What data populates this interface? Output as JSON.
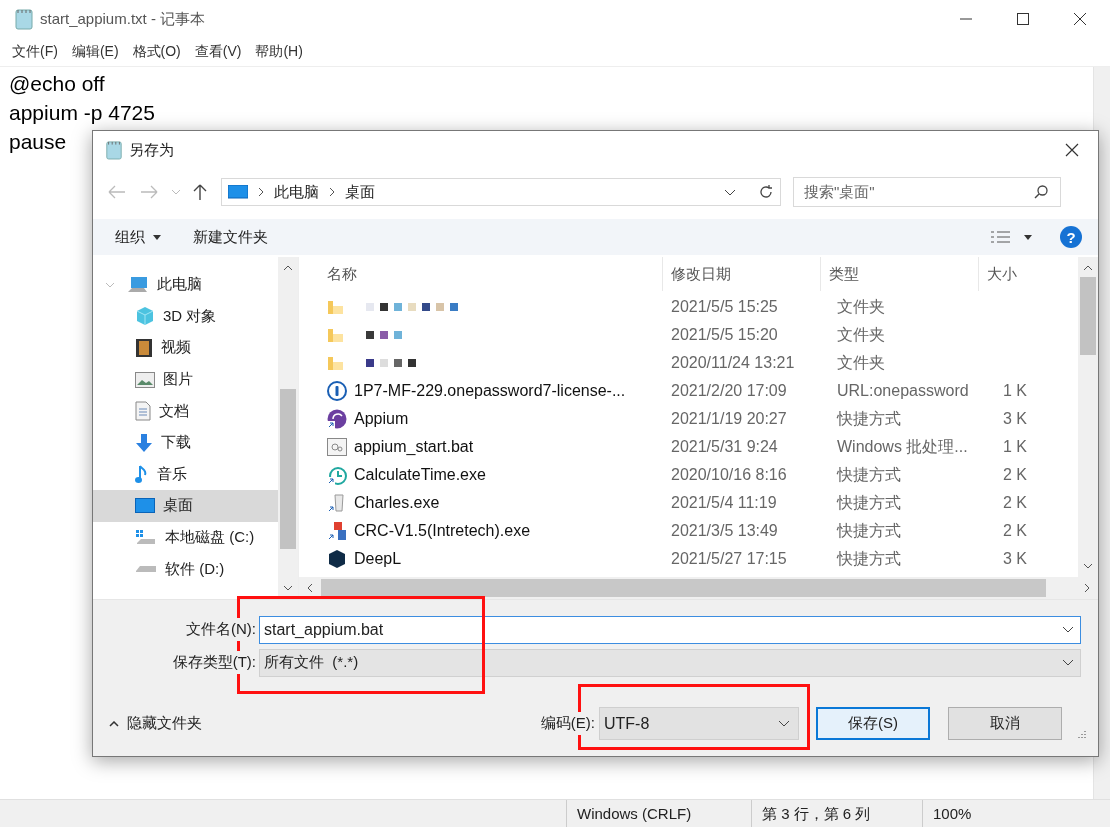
{
  "notepad": {
    "title": "start_appium.txt - 记事本",
    "menu": [
      "文件(F)",
      "编辑(E)",
      "格式(O)",
      "查看(V)",
      "帮助(H)"
    ],
    "lines": [
      "@echo off",
      "appium -p 4725",
      "pause"
    ],
    "status_bar": [
      "Windows (CRLF)",
      "第 3 行，第 6 列",
      "100%"
    ]
  },
  "dialog": {
    "title": "另存为",
    "breadcrumb": [
      "此电脑",
      "桌面"
    ],
    "search": {
      "placeholder": "搜索\"桌面\""
    },
    "organize": "组织",
    "new_folder": "新建文件夹",
    "help": "?",
    "sidebar": {
      "items": [
        {
          "label": "此电脑",
          "kind": "pc",
          "expanded": true,
          "selected": false,
          "children": [
            {
              "label": "3D 对象",
              "kind": "cube",
              "selected": false
            },
            {
              "label": "视频",
              "kind": "video",
              "selected": false
            },
            {
              "label": "图片",
              "kind": "image",
              "selected": false
            },
            {
              "label": "文档",
              "kind": "doc",
              "selected": false
            },
            {
              "label": "下载",
              "kind": "download",
              "selected": false
            },
            {
              "label": "音乐",
              "kind": "music",
              "selected": false
            },
            {
              "label": "桌面",
              "kind": "desktop",
              "selected": true
            },
            {
              "label": "本地磁盘 (C:)",
              "kind": "disk",
              "selected": false
            },
            {
              "label": "软件 (D:)",
              "kind": "drive",
              "selected": false
            }
          ]
        }
      ]
    },
    "columns": [
      "名称",
      "修改日期",
      "类型",
      "大小"
    ],
    "rows": [
      {
        "kind": "folder",
        "blurred": true,
        "date": "2021/5/5 15:25",
        "type": "文件夹"
      },
      {
        "kind": "folder",
        "blurred": true,
        "date": "2021/5/5 15:20",
        "type": "文件夹"
      },
      {
        "kind": "folder",
        "blurred": true,
        "date": "2020/11/24 13:21",
        "type": "文件夹"
      },
      {
        "kind": "url",
        "name": "1P7-MF-229.onepassword7-license-...",
        "date": "2021/2/20 17:09",
        "type": "URL:onepassword",
        "size": "1 K"
      },
      {
        "kind": "appium",
        "name": "Appium",
        "date": "2021/1/19 20:27",
        "type": "快捷方式",
        "size": "3 K"
      },
      {
        "kind": "bat",
        "name": "appium_start.bat",
        "date": "2021/5/31 9:24",
        "type": "Windows 批处理...",
        "size": "1 K"
      },
      {
        "kind": "clock",
        "name": "CalculateTime.exe",
        "date": "2020/10/16 8:16",
        "type": "快捷方式",
        "size": "2 K"
      },
      {
        "kind": "jug",
        "name": "Charles.exe",
        "date": "2021/5/4 11:19",
        "type": "快捷方式",
        "size": "2 K"
      },
      {
        "kind": "blocks",
        "name": "CRC-V1.5(Intretech).exe",
        "date": "2021/3/5 13:49",
        "type": "快捷方式",
        "size": "2 K"
      },
      {
        "kind": "deepl",
        "name": "DeepL",
        "date": "2021/5/27 17:15",
        "type": "快捷方式",
        "size": "3 K"
      }
    ],
    "filename": {
      "label": "文件名(N):",
      "value": "start_appium.bat"
    },
    "filetype": {
      "label": "保存类型(T):",
      "value": "所有文件  (*.*)"
    },
    "hide_folders": "隐藏文件夹",
    "encoding": {
      "label": "编码(E):",
      "value": "UTF-8"
    },
    "buttons": [
      "保存(S)",
      "取消"
    ]
  }
}
